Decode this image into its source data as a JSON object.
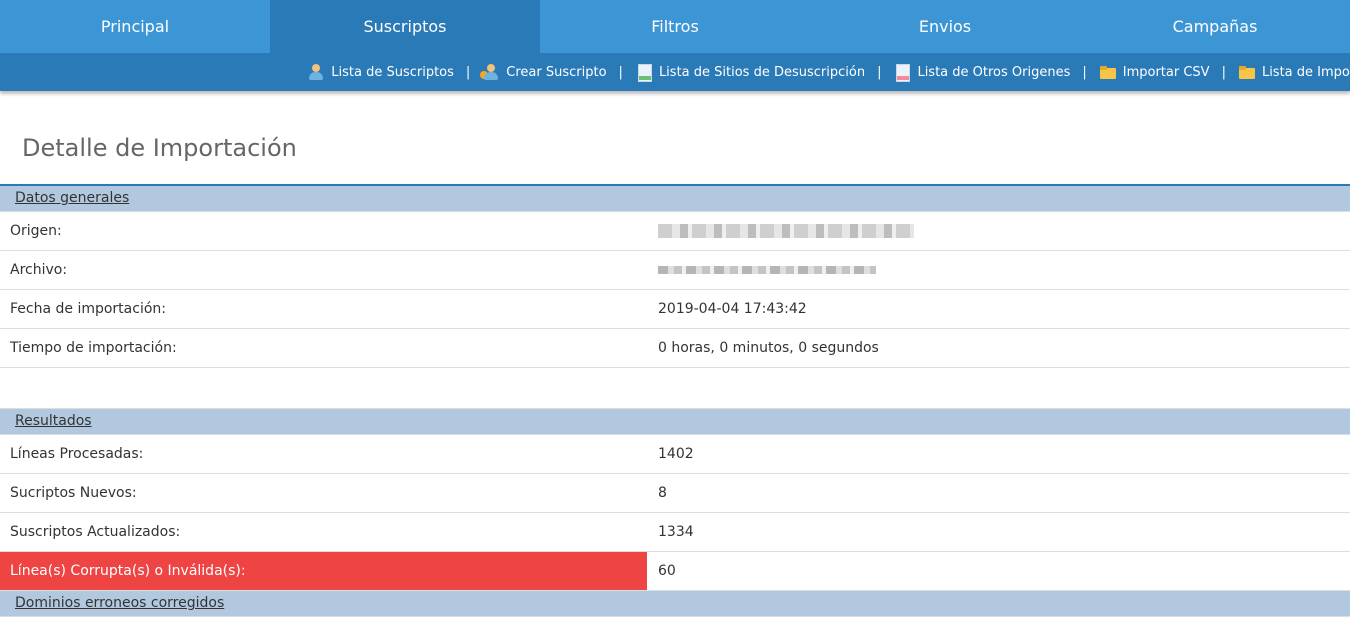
{
  "topnav": {
    "tabs": [
      {
        "label": "Principal",
        "active": false
      },
      {
        "label": "Suscriptos",
        "active": true
      },
      {
        "label": "Filtros",
        "active": false
      },
      {
        "label": "Envios",
        "active": false
      },
      {
        "label": "Campañas",
        "active": false
      }
    ]
  },
  "subnav": {
    "items": [
      {
        "label": "Lista de Suscriptos",
        "icon": "users-icon"
      },
      {
        "label": "Crear Suscripto",
        "icon": "add-user-icon"
      },
      {
        "label": "Lista de Sitios de Desuscripción",
        "icon": "document-green-icon"
      },
      {
        "label": "Lista de Otros Origenes",
        "icon": "document-pink-icon"
      },
      {
        "label": "Importar CSV",
        "icon": "folder-import-icon"
      },
      {
        "label": "Lista de Importaciones",
        "icon": "folder-list-icon"
      }
    ],
    "separator": "|"
  },
  "page": {
    "title": "Detalle de Importación"
  },
  "general": {
    "header": "Datos generales",
    "rows": [
      {
        "label": "Origen:",
        "value": ""
      },
      {
        "label": "Archivo:",
        "value": ""
      },
      {
        "label": "Fecha de importación:",
        "value": "2019-04-04 17:43:42"
      },
      {
        "label": "Tiempo de importación:",
        "value": "0 horas, 0 minutos, 0 segundos"
      }
    ]
  },
  "results": {
    "header": "Resultados",
    "rows": [
      {
        "label": "Líneas Procesadas:",
        "value": "1402"
      },
      {
        "label": "Sucriptos Nuevos:",
        "value": "8"
      },
      {
        "label": "Suscriptos Actualizados:",
        "value": "1334"
      },
      {
        "label": "Línea(s) Corrupta(s) o Inválida(s):",
        "value": "60"
      }
    ]
  },
  "domains": {
    "header": "Dominios erroneos corregidos"
  },
  "colors": {
    "nav": "#3c96d6",
    "nav_active": "#2a7ab8",
    "section": "#b2c8df",
    "alert": "#ee4444"
  }
}
